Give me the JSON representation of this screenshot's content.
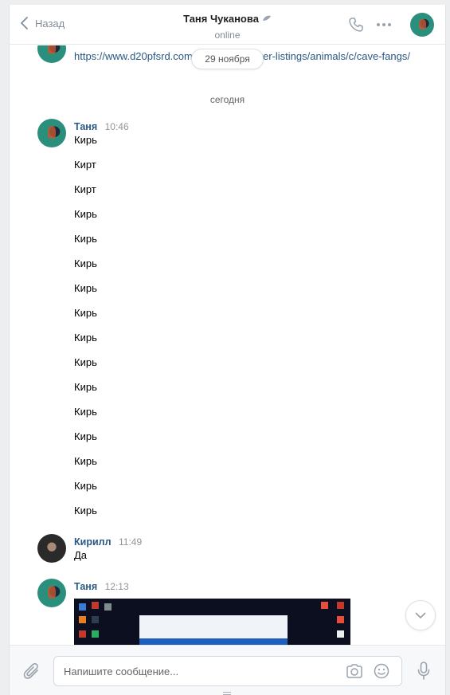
{
  "header": {
    "back_label": "Назад",
    "contact_name": "Таня Чуканова",
    "status": "online"
  },
  "feed": {
    "top_link": "https://www.d20pfsrd.com/bestiary/monster-listings/animals/c/cave-fangs/",
    "date_pill": "29 ноября",
    "today_label": "сегодня",
    "groups": [
      {
        "name": "Таня",
        "time": "10:46",
        "messages": [
          "Кирь",
          "Кирт",
          "Кирт",
          "Кирь",
          "Кирь",
          "Кирь",
          "Кирь",
          "Кирь",
          "Кирь",
          "Кирь",
          "Кирь",
          "Кирь",
          "Кирь",
          "Кирь",
          "Кирь",
          "Кирь"
        ]
      },
      {
        "name": "Кирилл",
        "time": "11:49",
        "messages": [
          "Да"
        ]
      },
      {
        "name": "Таня",
        "time": "12:13",
        "attachment": "screenshot-image"
      }
    ]
  },
  "composer": {
    "placeholder": "Напишите сообщение..."
  },
  "icons": {
    "back": "chevron-left-icon",
    "call": "phone-icon",
    "more": "more-dots-icon",
    "attach": "paperclip-icon",
    "camera": "camera-icon",
    "emoji": "smile-icon",
    "voice": "microphone-icon",
    "scroll": "chevron-down-icon"
  },
  "colors": {
    "link": "#2a5885",
    "muted": "#818c99",
    "background": "#edeef0"
  }
}
